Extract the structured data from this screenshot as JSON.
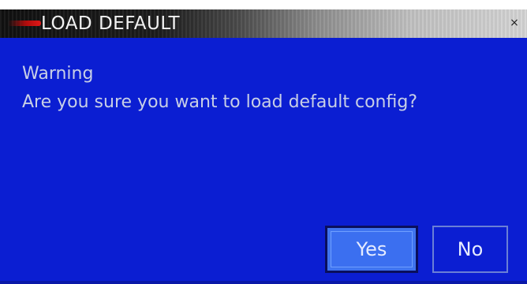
{
  "dialog": {
    "title": "LOAD DEFAULT",
    "close_glyph": "×",
    "heading": "Warning",
    "message": "Are you sure you want to load default config?",
    "yes_label": "Yes",
    "no_label": "No"
  },
  "colors": {
    "body_background": "#0b1ed2",
    "yes_button": "#3f74f0",
    "text": "#c8cfe6",
    "title_text": "#f2f2f2",
    "title_accent": "#d01414"
  },
  "icons": {
    "close": "close-icon",
    "title_accent": "red-accent-bar"
  }
}
